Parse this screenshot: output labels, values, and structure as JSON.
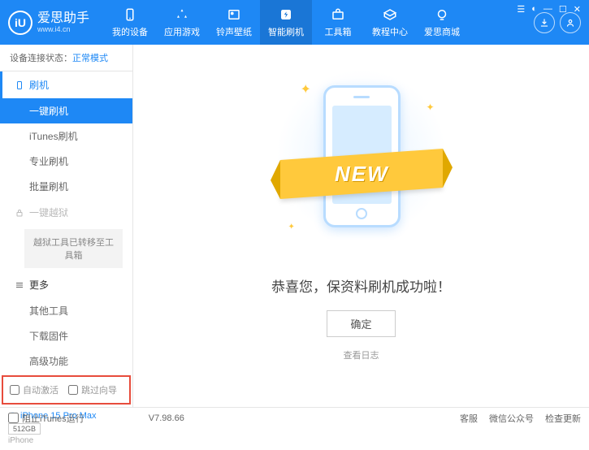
{
  "header": {
    "logo_text": "爱思助手",
    "logo_sub": "www.i4.cn",
    "logo_letter": "iU",
    "nav": [
      {
        "label": "我的设备"
      },
      {
        "label": "应用游戏"
      },
      {
        "label": "铃声壁纸"
      },
      {
        "label": "智能刷机"
      },
      {
        "label": "工具箱"
      },
      {
        "label": "教程中心"
      },
      {
        "label": "爱思商城"
      }
    ]
  },
  "sidebar": {
    "status_label": "设备连接状态：",
    "status_value": "正常模式",
    "section_flash": "刷机",
    "items_flash": [
      "一键刷机",
      "iTunes刷机",
      "专业刷机",
      "批量刷机"
    ],
    "section_jail": "一键越狱",
    "jail_moved": "越狱工具已转移至工具箱",
    "section_more": "更多",
    "items_more": [
      "其他工具",
      "下载固件",
      "高级功能"
    ],
    "cb_auto_activate": "自动激活",
    "cb_skip_guide": "跳过向导",
    "device_name": "iPhone 15 Pro Max",
    "device_storage": "512GB",
    "device_type": "iPhone"
  },
  "main": {
    "ribbon": "NEW",
    "success": "恭喜您，保资料刷机成功啦！",
    "ok": "确定",
    "view_log": "查看日志"
  },
  "footer": {
    "block_itunes": "阻止iTunes运行",
    "version": "V7.98.66",
    "links": [
      "客服",
      "微信公众号",
      "检查更新"
    ]
  }
}
